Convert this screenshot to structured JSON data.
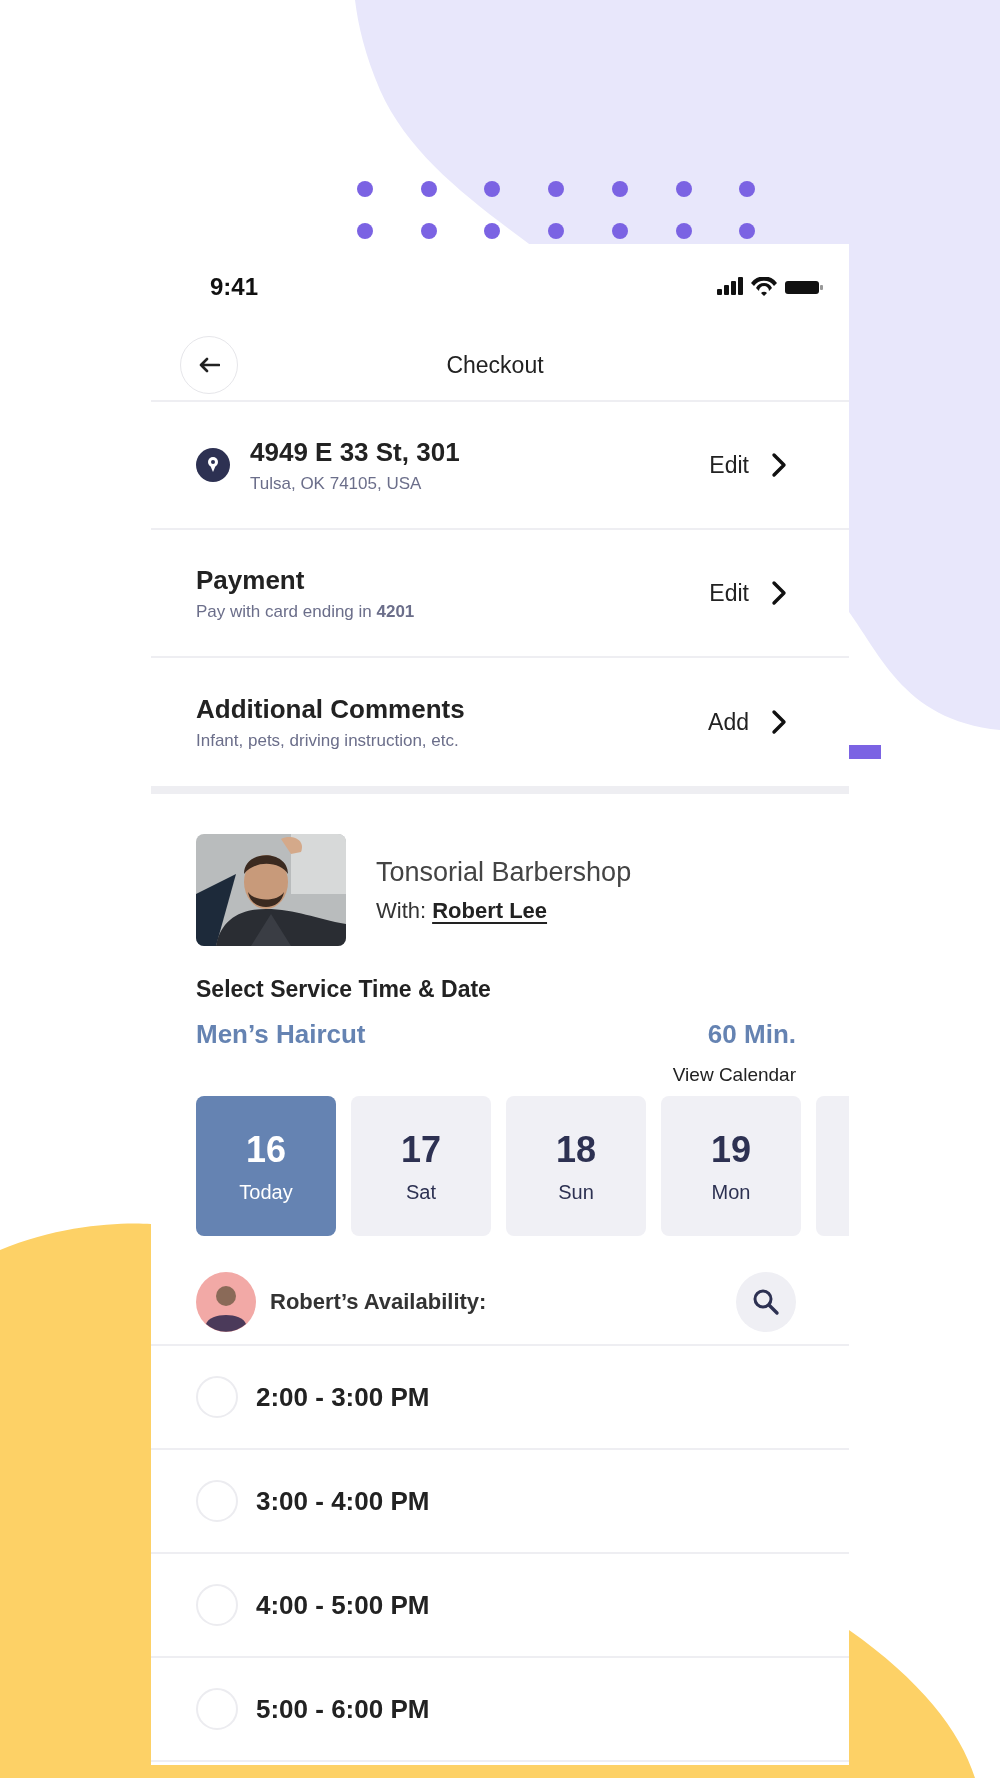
{
  "status_bar": {
    "time": "9:41"
  },
  "header": {
    "title": "Checkout"
  },
  "sections": [
    {
      "kind": "address",
      "title": "4949 E 33 St, 301",
      "subtitle": "Tulsa, OK 74105, USA",
      "action": "Edit"
    },
    {
      "kind": "plain",
      "title": "Payment",
      "subtitle": "Pay with card ending in **4201**",
      "action": "Edit"
    },
    {
      "kind": "plain",
      "title": "Additional Comments",
      "subtitle": "Infant, pets, driving instruction, etc.",
      "action": "Add"
    }
  ],
  "shop": {
    "name": "Tonsorial Barbershop",
    "with_label": "With:",
    "barber": "Robert Lee"
  },
  "service": {
    "heading": "Select Service Time & Date",
    "name": "Men’s Haircut",
    "duration": "60 Min.",
    "calendar_link": "View Calendar"
  },
  "dates": [
    {
      "day": "16",
      "label": "Today",
      "selected": true
    },
    {
      "day": "17",
      "label": "Sat",
      "selected": false
    },
    {
      "day": "18",
      "label": "Sun",
      "selected": false
    },
    {
      "day": "19",
      "label": "Mon",
      "selected": false
    }
  ],
  "availability": {
    "label": "Robert’s Availability:"
  },
  "slots": [
    {
      "time": "2:00 - 3:00 PM",
      "selected": false
    },
    {
      "time": "3:00 - 4:00 PM",
      "selected": false
    },
    {
      "time": "4:00 - 5:00 PM",
      "selected": false
    },
    {
      "time": "5:00 - 6:00 PM",
      "selected": false
    }
  ]
}
